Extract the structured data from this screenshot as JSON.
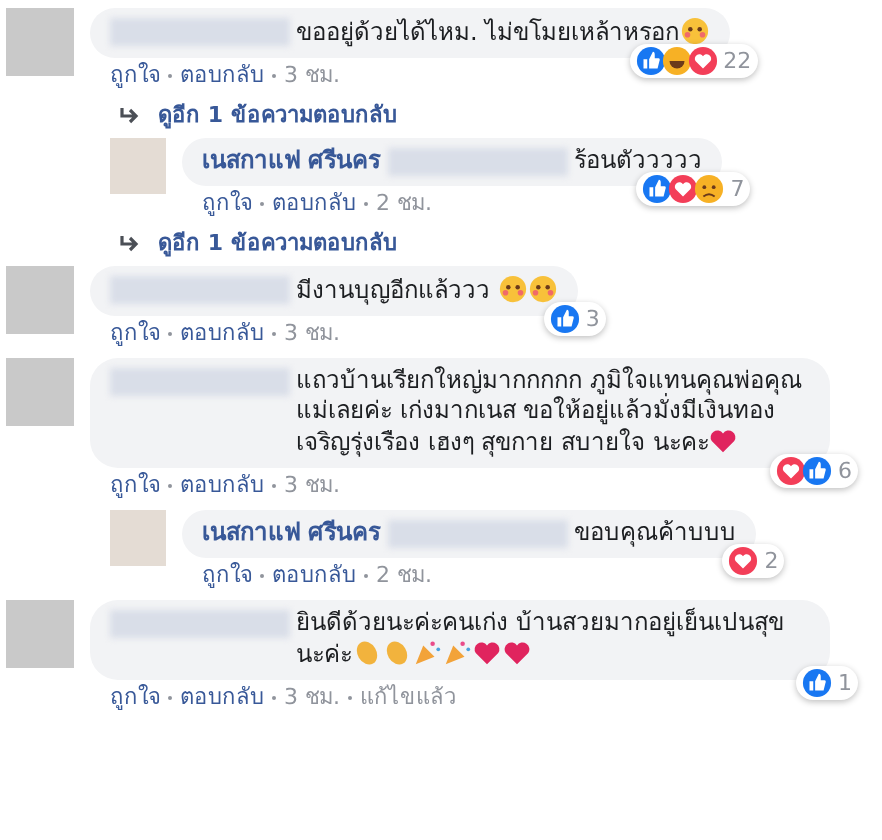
{
  "thread": [
    {
      "kind": "comment",
      "reply": false,
      "text": "ขออยู่ด้วยได้ไหม. ไม่ขโมยเหล้าหรอก",
      "emojis": [
        {
          "kind": "face"
        }
      ],
      "reactions": [
        {
          "kind": "like"
        },
        {
          "kind": "haha"
        },
        {
          "kind": "love"
        }
      ],
      "reaction_count": "22",
      "actions": [
        "ถูกใจ",
        "ตอบกลับ",
        "3 ชม."
      ]
    },
    {
      "kind": "more",
      "text": "ดูอีก 1 ข้อความตอบกลับ"
    },
    {
      "kind": "comment",
      "reply": true,
      "author": "เนสกาแฟ ศรีนคร",
      "text": "ร้อนตัววววว",
      "reactions": [
        {
          "kind": "like"
        },
        {
          "kind": "love"
        },
        {
          "kind": "sad"
        }
      ],
      "reaction_count": "7",
      "actions": [
        "ถูกใจ",
        "ตอบกลับ",
        "2 ชม."
      ]
    },
    {
      "kind": "more",
      "text": "ดูอีก 1 ข้อความตอบกลับ"
    },
    {
      "kind": "comment",
      "reply": false,
      "text": "มีงานบุญอีกแล้ววว ",
      "emojis": [
        {
          "kind": "face"
        },
        {
          "kind": "face"
        }
      ],
      "reactions": [
        {
          "kind": "like"
        }
      ],
      "reaction_count": "3",
      "actions": [
        "ถูกใจ",
        "ตอบกลับ",
        "3 ชม."
      ]
    },
    {
      "kind": "comment",
      "reply": false,
      "text": "แถวบ้านเรียกใหญ่มากกกกก ภูมิใจแทนคุณพ่อคุณแม่เลยค่ะ เก่งมากเนส ขอให้อยู่แล้วมั่งมีเงินทอง เจริญรุ่งเรือง เฮงๆ สุขกาย สบายใจ นะคะ",
      "emojis": [
        {
          "kind": "heart"
        }
      ],
      "reactions": [
        {
          "kind": "love"
        },
        {
          "kind": "like"
        }
      ],
      "reaction_count": "6",
      "actions": [
        "ถูกใจ",
        "ตอบกลับ",
        "3 ชม."
      ]
    },
    {
      "kind": "comment",
      "reply": true,
      "author": "เนสกาแฟ ศรีนคร",
      "text": "ขอบคุณค้าบบบ",
      "reactions": [
        {
          "kind": "love"
        }
      ],
      "reaction_count": "2",
      "actions": [
        "ถูกใจ",
        "ตอบกลับ",
        "2 ชม."
      ]
    },
    {
      "kind": "comment",
      "reply": false,
      "text": "ยินดีด้วยนะค่ะคนเก่ง บ้านสวยมากอยู่เย็นเปนสุขนะค่ะ",
      "emojis": [
        {
          "kind": "clap"
        },
        {
          "kind": "clap"
        },
        {
          "kind": "party"
        },
        {
          "kind": "party"
        },
        {
          "kind": "heart"
        },
        {
          "kind": "heart"
        }
      ],
      "reactions": [
        {
          "kind": "like"
        }
      ],
      "reaction_count": "1",
      "actions": [
        "ถูกใจ",
        "ตอบกลับ",
        "3 ชม.",
        "แก้ไขแล้ว"
      ]
    }
  ]
}
